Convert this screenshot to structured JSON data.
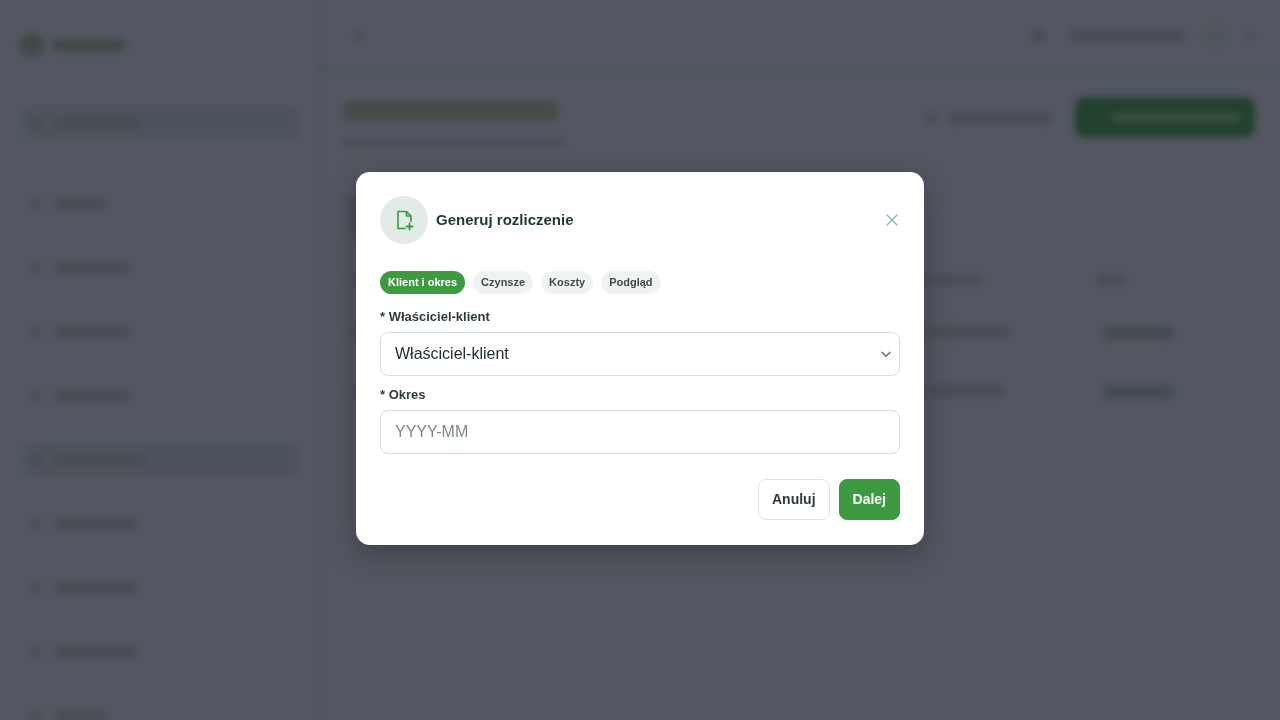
{
  "dialog": {
    "title": "Generuj rozliczenie"
  },
  "steps": [
    {
      "label": "Klient i okres",
      "selected": true
    },
    {
      "label": "Czynsze",
      "selected": false
    },
    {
      "label": "Koszty",
      "selected": false
    },
    {
      "label": "Podgląd",
      "selected": false
    }
  ],
  "fields": [
    {
      "kind": "select",
      "label": "* Właściciel-klient",
      "value": "Właściciel-klient"
    },
    {
      "kind": "text",
      "label": "* Okres",
      "placeholder": "YYYY-MM"
    }
  ],
  "buttons": [
    {
      "kind": "secondary",
      "label": "Anuluj"
    },
    {
      "kind": "primary",
      "label": "Dalej"
    }
  ]
}
